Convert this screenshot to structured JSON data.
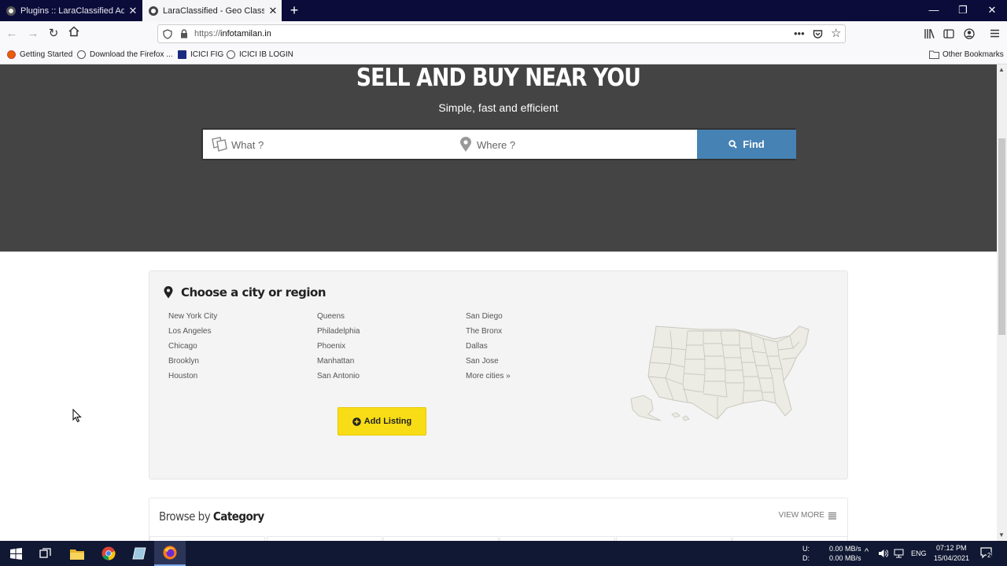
{
  "browser": {
    "tabs": [
      {
        "title": "Plugins :: LaraClassified Admin"
      },
      {
        "title": "LaraClassified - Geo Classified A"
      }
    ],
    "url_prefix": "https://",
    "url_host": "infotamilan.in",
    "bookmarks": [
      "Getting Started",
      "Download the Firefox ...",
      "ICICI FIG",
      "ICICI IB LOGIN"
    ],
    "other_bookmarks": "Other Bookmarks"
  },
  "hero": {
    "title": "SELL AND BUY NEAR YOU",
    "subtitle": "Simple, fast and efficient",
    "what_placeholder": "What ?",
    "where_placeholder": "Where ?",
    "find_label": "Find"
  },
  "cities": {
    "title": "Choose a city or region",
    "columns": [
      [
        "New York City",
        "Los Angeles",
        "Chicago",
        "Brooklyn",
        "Houston"
      ],
      [
        "Queens",
        "Philadelphia",
        "Phoenix",
        "Manhattan",
        "San Antonio"
      ],
      [
        "San Diego",
        "The Bronx",
        "Dallas",
        "San Jose",
        "More cities »"
      ]
    ],
    "add_listing": "Add Listing"
  },
  "category": {
    "title_light": "Browse by ",
    "title_bold": "Category",
    "view_more": "VIEW MORE"
  },
  "taskbar": {
    "net_up_label": "U:",
    "net_down_label": "D:",
    "net_up": "0.00 MB/s",
    "net_down": "0.00 MB/s",
    "lang": "ENG",
    "time": "07:12 PM",
    "date": "15/04/2021",
    "notifications": "2"
  },
  "colors": {
    "hero_bg": "#444444",
    "find_button": "#4682b4",
    "add_button": "#f8dd16",
    "taskbar": "#101833",
    "tabstrip": "#0c0c3a"
  }
}
